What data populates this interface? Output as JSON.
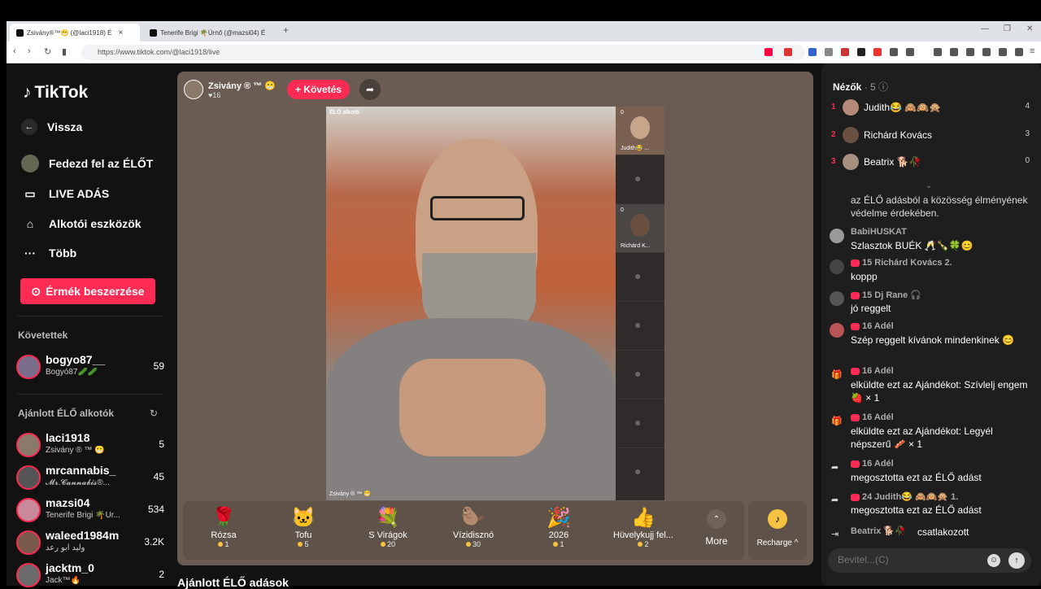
{
  "browser": {
    "tabs": [
      {
        "label": "Zsivány®™😁 (@laci1918) É"
      },
      {
        "label": "Tenerife Brigi 🌴Úrnő (@mazsi04) É"
      }
    ],
    "url": "https://www.tiktok.com/@laci1918/live"
  },
  "sidebar": {
    "logo": "TikTok",
    "back": "Vissza",
    "nav": [
      {
        "label": "Fedezd fel az ÉLŐT",
        "icon": "avatar-icon"
      },
      {
        "label": "LIVE ADÁS",
        "icon": "camera-icon"
      },
      {
        "label": "Alkotói eszközök",
        "icon": "creator-tools-icon"
      },
      {
        "label": "Több",
        "icon": "more-icon"
      }
    ],
    "coins_button": "Érmék beszerzése",
    "following_heading": "Követettek",
    "following": [
      {
        "name": "bogyo87__",
        "sub": "Bogyó87🥒🥒",
        "count": "59"
      }
    ],
    "suggested_heading": "Ajánlott ÉLŐ alkotók",
    "suggested": [
      {
        "name": "laci1918",
        "sub": "Zsivány ® ™ 😁",
        "count": "5"
      },
      {
        "name": "mrcannabis_",
        "sub": "𝓜𝓻.𝓒𝓪𝓷𝓷𝓪𝓫𝓲𝓼®...",
        "count": "45"
      },
      {
        "name": "mazsi04",
        "sub": "Tenerife Brigi 🌴Úr...",
        "count": "534"
      },
      {
        "name": "waleed1984m",
        "sub": "وليد ابو رعد",
        "count": "3.2K"
      },
      {
        "name": "jacktm_0",
        "sub": "Jack™🔥",
        "count": "2"
      }
    ]
  },
  "stream": {
    "host_name": "Zsivány ® ™ 😁",
    "host_likes": "♥16",
    "follow_button": "+ Követés",
    "live_tag": "ÉLŐ alkotó",
    "video_name": "Zsivány ® ™ 😁",
    "guests": [
      {
        "num": "0",
        "name": "Judith😂 ..."
      },
      {
        "num": "",
        "name": ""
      },
      {
        "num": "0",
        "name": "Richárd K..."
      },
      {
        "num": "",
        "name": ""
      },
      {
        "num": "",
        "name": ""
      },
      {
        "num": "",
        "name": ""
      },
      {
        "num": "",
        "name": ""
      },
      {
        "num": "",
        "name": ""
      }
    ],
    "gifts": [
      {
        "label": "Rózsa",
        "price": "1",
        "icon": "🌹"
      },
      {
        "label": "Tofu",
        "price": "5",
        "icon": "🐱"
      },
      {
        "label": "S Virágok",
        "price": "20",
        "icon": "💐"
      },
      {
        "label": "Vízidisznó",
        "price": "30",
        "icon": "🦫"
      },
      {
        "label": "2026",
        "price": "1",
        "icon": "🎉"
      },
      {
        "label": "Hüvelykujj fel...",
        "price": "2",
        "icon": "👍"
      }
    ],
    "more_label": "More",
    "recharge_label": "Recharge ^"
  },
  "below_title": "Ajánlott ÉLŐ adások",
  "chat": {
    "viewers_heading": "Nézők",
    "viewers_count": "· 5",
    "viewers": [
      {
        "rank": "1",
        "name": "Judith😂 🙈🙉🙊",
        "score": "4"
      },
      {
        "rank": "2",
        "name": "Richárd Kovács",
        "score": "3"
      },
      {
        "rank": "3",
        "name": "Beatrix 🐕🥀",
        "score": "0"
      }
    ],
    "messages": [
      {
        "name": "",
        "text": "az ÉLŐ adásból a közösség élményének védelme érdekében."
      },
      {
        "name": "BabiHUSKAT",
        "text": "Szlasztok BUÉK 🥂🍾🍀😊"
      },
      {
        "name": "15 Richárd Kovács 2.",
        "text": "koppp"
      },
      {
        "name": "15 Dj Rane 🎧",
        "text": "jó reggelt"
      },
      {
        "name": "16 Adél",
        "text": "Szép reggelt kívánok mindenkinek 😊"
      },
      {
        "name": "16 Adél",
        "text": "elküldte ezt az Ajándékot: Szívlelj engem 🍓 × 1"
      },
      {
        "name": "16 Adél",
        "text": "elküldte ezt az Ajándékot: Legyél népszerű 🥓 × 1"
      },
      {
        "name": "16 Adél",
        "text": "megosztotta ezt az ÉLŐ adást"
      },
      {
        "name": "24 Judith😂 🙈🙉🙊 1.",
        "text": "megosztotta ezt az ÉLŐ adást"
      },
      {
        "name": "Beatrix 🐕🥀",
        "text": "csatlakozott"
      }
    ],
    "input_placeholder": "Bevitel...(C)"
  },
  "colors": {
    "accent": "#fe2c55",
    "panel": "#1e1e1e",
    "player_bg": "#6a5c52"
  }
}
